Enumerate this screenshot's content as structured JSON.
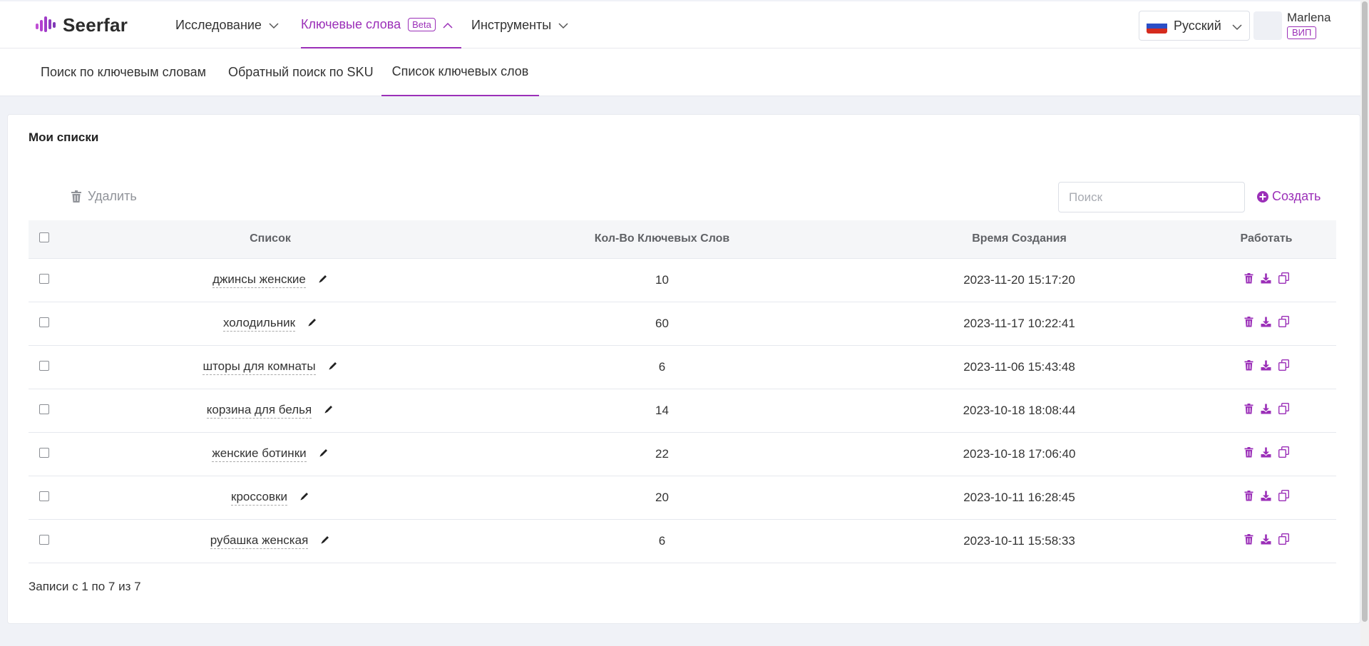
{
  "header": {
    "logo_text": "Seerfar",
    "nav": [
      {
        "label": "Исследование",
        "active": false
      },
      {
        "label": "Ключевые слова",
        "active": true,
        "badge": "Beta"
      },
      {
        "label": "Инструменты",
        "active": false
      }
    ],
    "language": {
      "label": "Русский",
      "flag": "russia-flag-icon"
    },
    "user": {
      "name": "Marlena",
      "badge": "ВИП"
    }
  },
  "subtabs": [
    {
      "label": "Поиск по ключевым словам",
      "active": false
    },
    {
      "label": "Обратный поиск по SKU",
      "active": false
    },
    {
      "label": "Список ключевых слов",
      "active": true
    }
  ],
  "card": {
    "title": "Мои списки",
    "delete_label": "Удалить",
    "search_placeholder": "Поиск",
    "create_label": "Создать",
    "columns": [
      "Список",
      "Кол-Во Ключевых Слов",
      "Время Создания",
      "Работать"
    ],
    "rows": [
      {
        "name": "джинсы женские",
        "count": "10",
        "created": "2023-11-20 15:17:20"
      },
      {
        "name": "холодильник",
        "count": "60",
        "created": "2023-11-17 10:22:41"
      },
      {
        "name": "шторы для комнаты",
        "count": "6",
        "created": "2023-11-06 15:43:48"
      },
      {
        "name": "корзина для белья",
        "count": "14",
        "created": "2023-10-18 18:08:44"
      },
      {
        "name": "женские ботинки",
        "count": "22",
        "created": "2023-10-18 17:06:40"
      },
      {
        "name": "кроссовки",
        "count": "20",
        "created": "2023-10-11 16:28:45"
      },
      {
        "name": "рубашка женская",
        "count": "6",
        "created": "2023-10-11 15:58:33"
      }
    ],
    "records_text": "Записи с 1 по 7 из 7"
  },
  "colors": {
    "accent": "#9b2fb8",
    "text": "#333333",
    "muted": "#909399",
    "background": "#f0f2f7"
  }
}
